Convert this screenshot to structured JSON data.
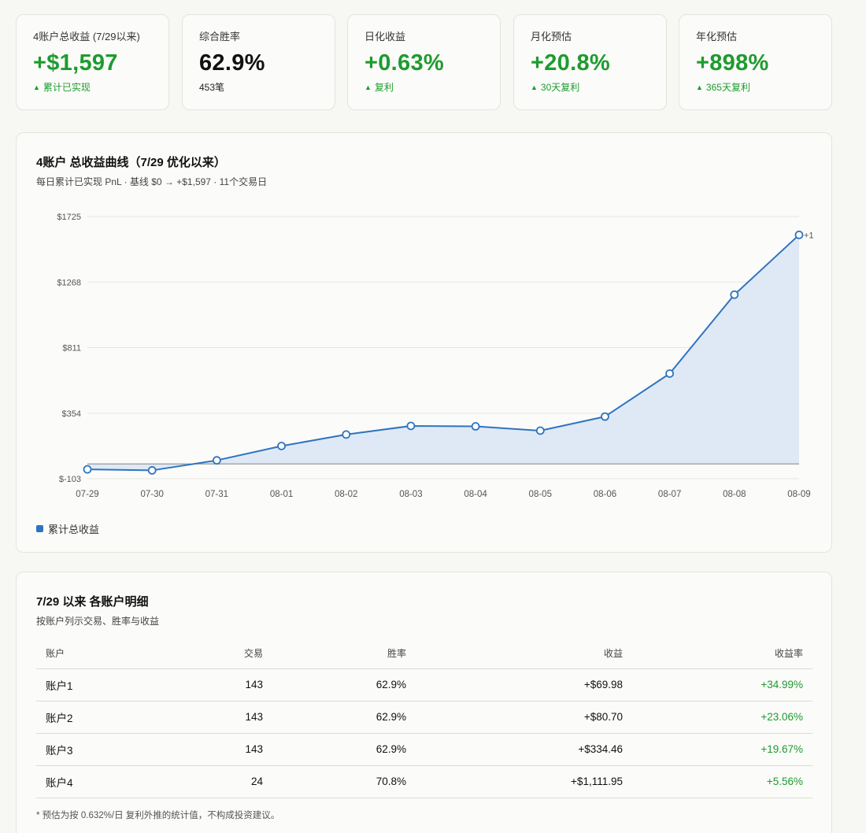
{
  "kpis": [
    {
      "label": "4账户总收益 (7/29以来)",
      "value": "+$1,597",
      "sub": "累计已实现",
      "value_color": "green",
      "sub_color": "green",
      "sub_arrow": true
    },
    {
      "label": "综合胜率",
      "value": "62.9%",
      "sub": "453笔",
      "value_color": "dark",
      "sub_color": "dark",
      "sub_arrow": false
    },
    {
      "label": "日化收益",
      "value": "+0.63%",
      "sub": "复利",
      "value_color": "green",
      "sub_color": "green",
      "sub_arrow": true
    },
    {
      "label": "月化预估",
      "value": "+20.8%",
      "sub": "30天复利",
      "value_color": "green",
      "sub_color": "green",
      "sub_arrow": true
    },
    {
      "label": "年化预估",
      "value": "+898%",
      "sub": "365天复利",
      "value_color": "green",
      "sub_color": "green",
      "sub_arrow": true
    }
  ],
  "arrow_glyph": "▲",
  "chart_panel": {
    "title": "4账户 总收益曲线（7/29 优化以来）",
    "subtitle": "每日累计已实现 PnL · 基线 $0 → +$1,597 · 11个交易日"
  },
  "chart_data": {
    "type": "area",
    "x": [
      "07-29",
      "07-30",
      "07-31",
      "08-01",
      "08-02",
      "08-03",
      "08-04",
      "08-05",
      "08-06",
      "08-07",
      "08-08",
      "08-09"
    ],
    "series": [
      {
        "name": "累计总收益",
        "values": [
          -38,
          -45,
          25,
          125,
          205,
          265,
          262,
          232,
          330,
          630,
          1180,
          1597
        ]
      }
    ],
    "y_ticks": [
      "$1725",
      "$1268",
      "$811",
      "$354",
      "$-103"
    ],
    "y_tick_values": [
      1725,
      1268,
      811,
      354,
      -103
    ],
    "ylim": [
      -103,
      1725
    ],
    "baseline": 0,
    "end_label": "+1",
    "grid": true,
    "legend_position": "bottom-left",
    "line_color": "#2e74c0",
    "fill_color": "#dfe9f6"
  },
  "table_panel": {
    "title": "7/29 以来 各账户明细",
    "subtitle": "按账户列示交易、胜率与收益",
    "columns": [
      "账户",
      "交易",
      "胜率",
      "收益",
      "收益率"
    ],
    "rows": [
      [
        "账户1",
        "143",
        "62.9%",
        "+$69.98",
        "+34.99%"
      ],
      [
        "账户2",
        "143",
        "62.9%",
        "+$80.70",
        "+23.06%"
      ],
      [
        "账户3",
        "143",
        "62.9%",
        "+$334.46",
        "+19.67%"
      ],
      [
        "账户4",
        "24",
        "70.8%",
        "+$1,111.95",
        "+5.56%"
      ]
    ],
    "footnote": "* 预估为按 0.632%/日 复利外推的统计值，不构成投资建议。"
  },
  "colors": {
    "green": "#1e9b2e",
    "accent_blue": "#2e74c0"
  }
}
